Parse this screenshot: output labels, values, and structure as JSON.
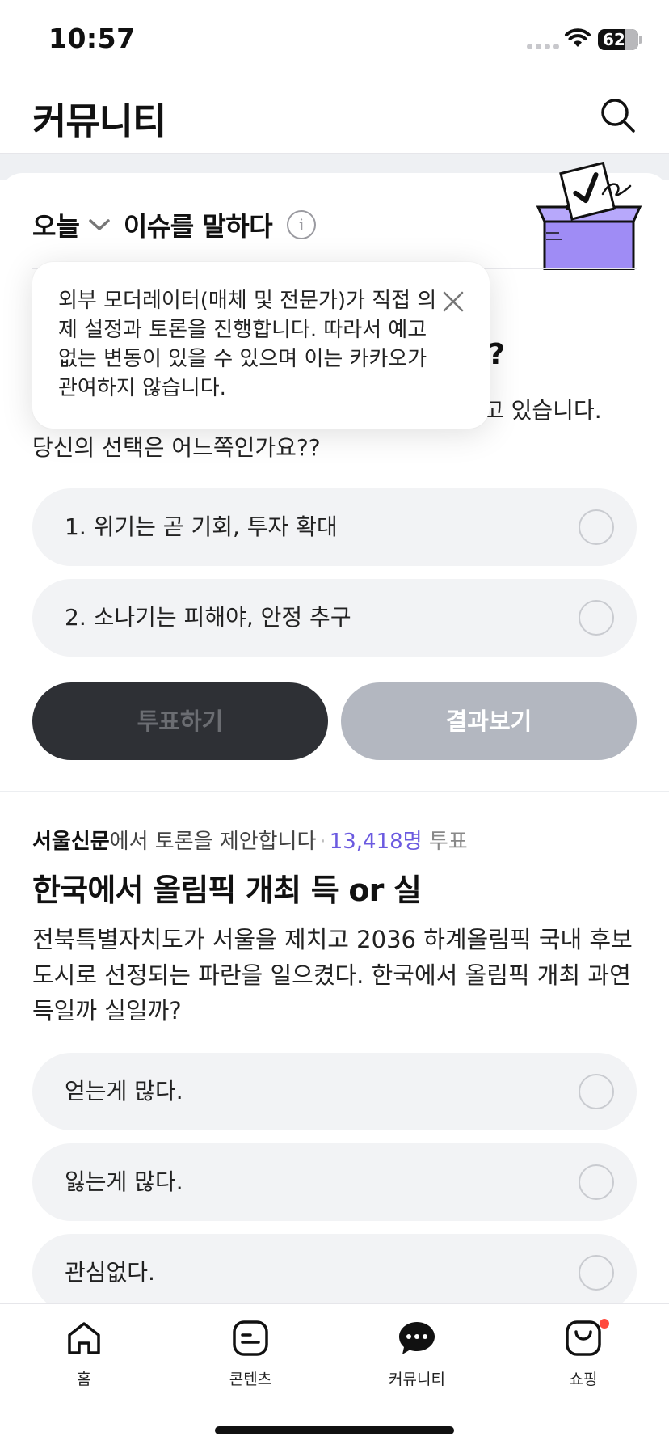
{
  "status_bar": {
    "time": "10:57",
    "battery": "62"
  },
  "header": {
    "title": "커뮤니티",
    "search_icon": "search-icon"
  },
  "issue": {
    "day_label": "오늘",
    "title": "이슈를 말하다",
    "info_icon": "info-icon",
    "info_glyph": "i",
    "question_fragment": "?",
    "desc_fragment": "고 있습니다.",
    "desc_line2": "당신의 선택은 어느쪽인가요??",
    "options": [
      {
        "label": "1. 위기는 곧 기회, 투자 확대"
      },
      {
        "label": "2. 소나기는 피해야, 안정 추구"
      }
    ],
    "vote_button": "투표하기",
    "result_button": "결과보기"
  },
  "tooltip": {
    "text": "외부 모더레이터(매체 및 전문가)가 직접 의제 설정과 토론을 진행합니다. 따라서 예고없는 변동이 있을 수 있으며 이는 카카오가 관여하지 않습니다.",
    "close_icon": "close-icon"
  },
  "proposal": {
    "org": "서울신문",
    "text": "에서 토론을 제안합니다",
    "separator": "·",
    "vote_count": "13,418명",
    "vote_label": "투표",
    "title": "한국에서 올림픽 개최 득 or 실",
    "description": "전북특별자치도가 서울을 제치고 2036 하계올림픽 국내 후보도시로 선정되는 파란을 일으켰다. 한국에서 올림픽 개최 과연 득일까 실일까?",
    "options": [
      {
        "label": "얻는게 많다."
      },
      {
        "label": "잃는게 많다."
      },
      {
        "label": "관심없다."
      }
    ]
  },
  "tab_bar": {
    "tabs": [
      {
        "label": "홈",
        "icon": "home-icon"
      },
      {
        "label": "콘텐츠",
        "icon": "content-icon"
      },
      {
        "label": "커뮤니티",
        "icon": "community-icon"
      },
      {
        "label": "쇼핑",
        "icon": "shopping-icon"
      }
    ]
  },
  "colors": {
    "accent": "#6b5ae0",
    "dark_button": "#2e3035",
    "disabled_button": "#b3b7c0",
    "badge": "#ff4a3d",
    "ballot_box": "#9f8cf5"
  }
}
